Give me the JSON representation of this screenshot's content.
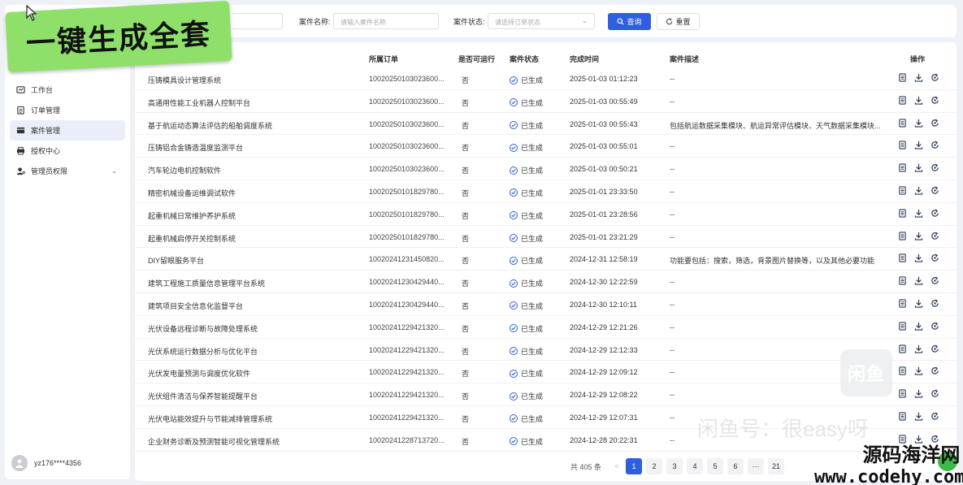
{
  "banner": {
    "text": "一键生成全套"
  },
  "sidebar": {
    "items": [
      {
        "label": "工作台",
        "icon": "dashboard-icon"
      },
      {
        "label": "订单管理",
        "icon": "clipboard-icon"
      },
      {
        "label": "案件管理",
        "icon": "folder-icon",
        "active": true
      },
      {
        "label": "授权中心",
        "icon": "printer-icon"
      },
      {
        "label": "管理员权限",
        "icon": "user-key-icon",
        "expandable": true
      }
    ],
    "user": {
      "name": "yz176****4356"
    }
  },
  "filter": {
    "name_label": "案件名称:",
    "name_placeholder": "请输入案件名称",
    "status_label": "案件状态:",
    "status_placeholder": "请选择订单状态",
    "search_label": "查询",
    "reset_label": "重置"
  },
  "table": {
    "headers": {
      "order": "所属订单",
      "runnable": "是否可运行",
      "status": "案件状态",
      "time": "完成时间",
      "desc": "案件描述",
      "ops": "操作"
    },
    "rows": [
      {
        "name": "压铸模具设计管理系统",
        "order": "10020250103023600...",
        "runnable": "否",
        "status": "已生成",
        "time": "2025-01-03 01:12:23",
        "desc": "--"
      },
      {
        "name": "高通用性能工业机器人控制平台",
        "order": "10020250103023600...",
        "runnable": "否",
        "status": "已生成",
        "time": "2025-01-03 00:55:49",
        "desc": "--"
      },
      {
        "name": "基于航运动态算法评估的船舶调度系统",
        "order": "10020250103023600...",
        "runnable": "否",
        "status": "已生成",
        "time": "2025-01-03 00:55:43",
        "desc": "包括航运数据采集模块、航运异常评估模块、天气数据采集模块..."
      },
      {
        "name": "压铸铝合金铸造温度监测平台",
        "order": "10020250103023600...",
        "runnable": "否",
        "status": "已生成",
        "time": "2025-01-03 00:55:01",
        "desc": "--"
      },
      {
        "name": "汽车轮边电机控制软件",
        "order": "10020250103023600...",
        "runnable": "否",
        "status": "已生成",
        "time": "2025-01-03 00:50:21",
        "desc": "--"
      },
      {
        "name": "精密机械设备运维调试软件",
        "order": "10020250101829780...",
        "runnable": "否",
        "status": "已生成",
        "time": "2025-01-01 23:33:50",
        "desc": "--"
      },
      {
        "name": "起重机械日常维护养护系统",
        "order": "10020250101829780...",
        "runnable": "否",
        "status": "已生成",
        "time": "2025-01-01 23:28:56",
        "desc": "--"
      },
      {
        "name": "起重机械启停开关控制系统",
        "order": "10020250101829780...",
        "runnable": "否",
        "status": "已生成",
        "time": "2025-01-01 23:21:29",
        "desc": "--"
      },
      {
        "name": "DIY留眼服务平台",
        "order": "10020241231450820...",
        "runnable": "否",
        "status": "已生成",
        "time": "2024-12-31 12:58:19",
        "desc": "功能要包括：搜索，筛选，背景图片替换等，以及其他必要功能"
      },
      {
        "name": "建筑工程施工质量信息管理平台系统",
        "order": "10020241230429440...",
        "runnable": "否",
        "status": "已生成",
        "time": "2024-12-30 12:22:59",
        "desc": "--"
      },
      {
        "name": "建筑项目安全信息化监督平台",
        "order": "10020241230429440...",
        "runnable": "否",
        "status": "已生成",
        "time": "2024-12-30 12:10:11",
        "desc": "--"
      },
      {
        "name": "光伏设备远程诊断与故障处理系统",
        "order": "10020241229421320...",
        "runnable": "否",
        "status": "已生成",
        "time": "2024-12-29 12:21:26",
        "desc": "--"
      },
      {
        "name": "光伏系统运行数据分析与优化平台",
        "order": "10020241229421320...",
        "runnable": "否",
        "status": "已生成",
        "time": "2024-12-29 12:12:33",
        "desc": "--"
      },
      {
        "name": "光伏发电量预测与调度优化软件",
        "order": "10020241229421320...",
        "runnable": "否",
        "status": "已生成",
        "time": "2024-12-29 12:09:12",
        "desc": "--"
      },
      {
        "name": "光伏组件清洁与保养智能提醒平台",
        "order": "10020241229421320...",
        "runnable": "否",
        "status": "已生成",
        "time": "2024-12-29 12:08:22",
        "desc": "--"
      },
      {
        "name": "光伏电站能效提升与节能减排管理系统",
        "order": "10020241229421320...",
        "runnable": "否",
        "status": "已生成",
        "time": "2024-12-29 12:07:31",
        "desc": "--"
      },
      {
        "name": "企业财务诊断及预测智能可视化管理系统",
        "order": "10020241228713720...",
        "runnable": "否",
        "status": "已生成",
        "time": "2024-12-28 20:22:31",
        "desc": "--"
      }
    ]
  },
  "pagination": {
    "total": "共 405 条",
    "pages": [
      "1",
      "2",
      "3",
      "4",
      "5",
      "6",
      "···",
      "21"
    ],
    "current": "1",
    "prev": "<"
  },
  "watermarks": {
    "box": "闲鱼",
    "text": "闲鱼号：很easy呀",
    "site_cn": "源码海洋网",
    "site_url": "www.codehy.com"
  },
  "colors": {
    "primary": "#2f5fe0",
    "banner": "#8ee06a",
    "background": "#eef1f5"
  }
}
